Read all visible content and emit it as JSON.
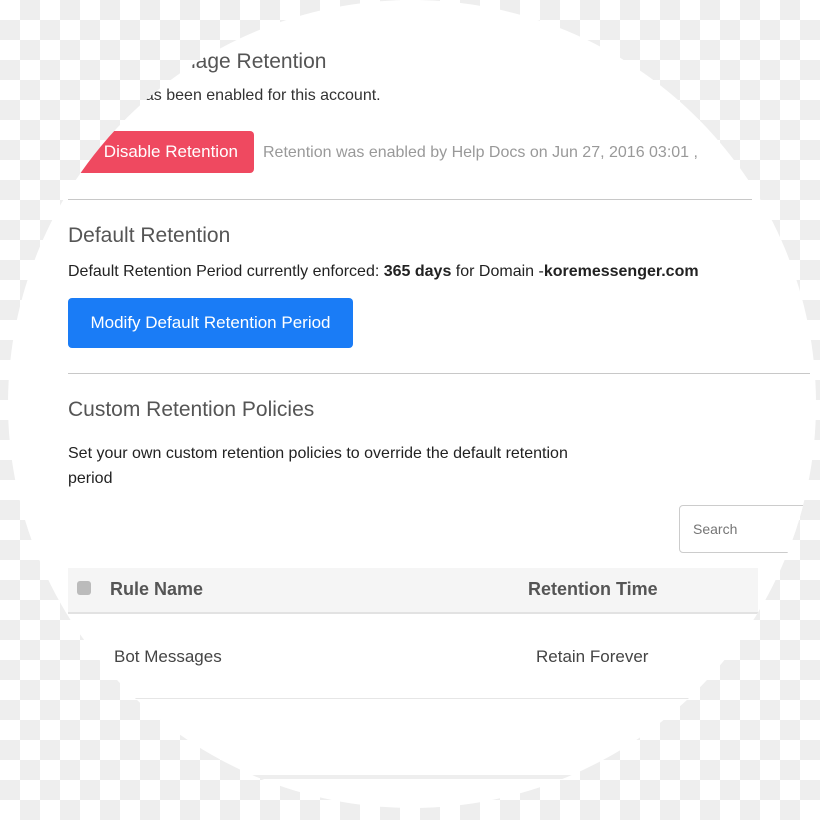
{
  "manage": {
    "title": "nage Retention",
    "status": "has been enabled for this account.",
    "disable_button": "Disable Retention",
    "enabled_info": "Retention was enabled by Help Docs on Jun 27, 2016 03:01 ,"
  },
  "default_retention": {
    "title": "Default Retention",
    "text_prefix": "Default Retention Period currently enforced: ",
    "period": "365 days",
    "text_mid": " for Domain -",
    "domain": "koremessenger.com",
    "modify_button": "Modify Default Retention Period"
  },
  "custom": {
    "title": "Custom Retention Policies",
    "description_line1": "Set your own custom retention policies to override the default retention",
    "description_line2": "period",
    "search_placeholder": "Search",
    "table": {
      "columns": [
        "Rule Name",
        "Retention Time"
      ],
      "rows": [
        {
          "rule_name": "Bot Messages",
          "retention_time": "Retain Forever"
        }
      ]
    }
  },
  "colors": {
    "danger": "#ef4960",
    "primary": "#1a7cf6"
  }
}
